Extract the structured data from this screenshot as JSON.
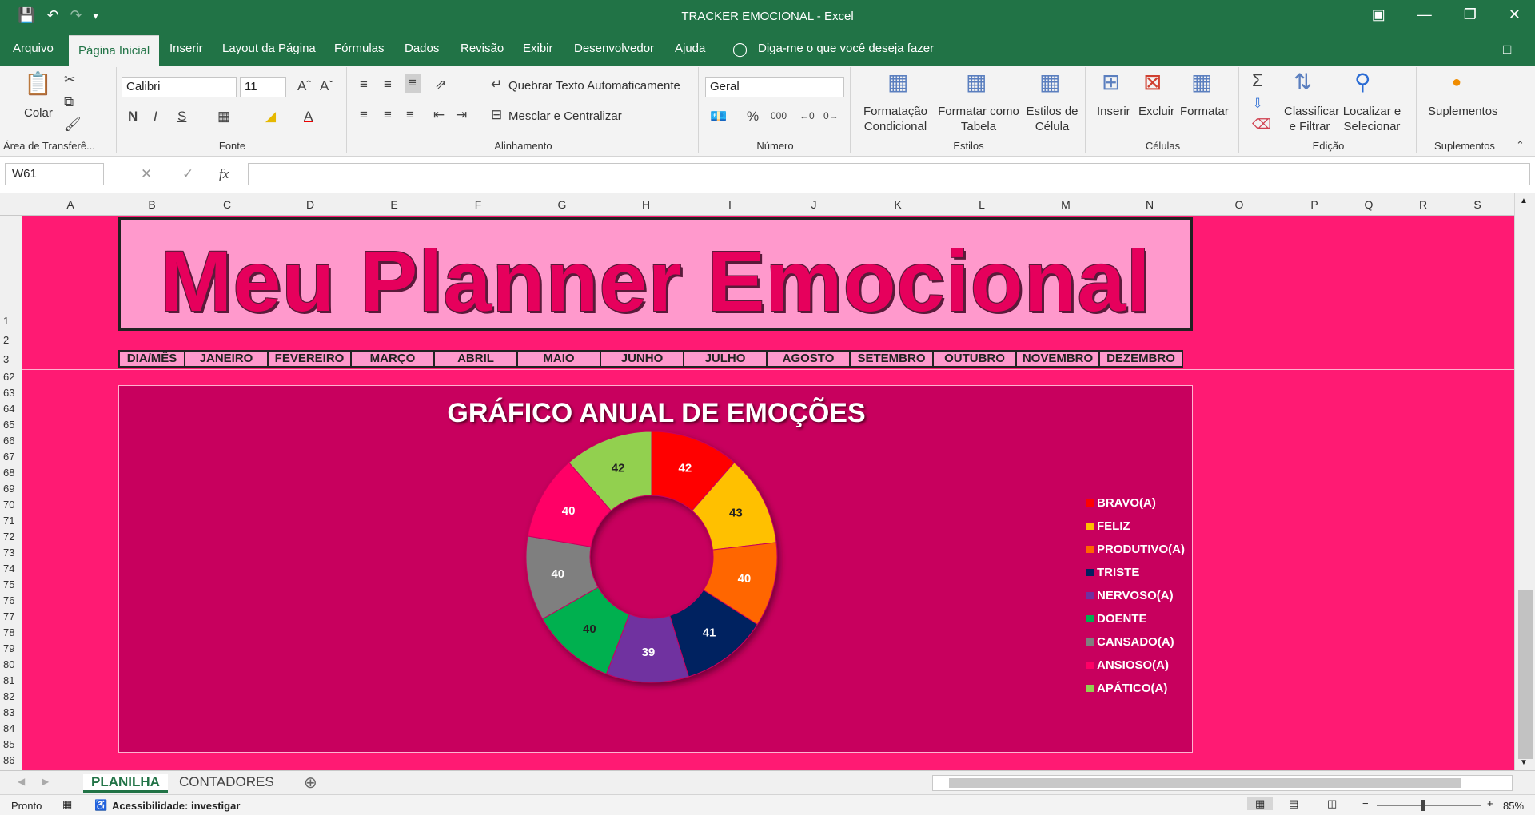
{
  "window": {
    "title": "TRACKER EMOCIONAL  -  Excel"
  },
  "menu": {
    "tabs": [
      "Arquivo",
      "Página Inicial",
      "Inserir",
      "Layout da Página",
      "Fórmulas",
      "Dados",
      "Revisão",
      "Exibir",
      "Desenvolvedor",
      "Ajuda"
    ],
    "tell_me": "Diga-me o que você deseja fazer"
  },
  "ribbon": {
    "clipboard": {
      "paste": "Colar",
      "label": "Área de Transferê..."
    },
    "font": {
      "name": "Calibri",
      "size": "11",
      "label": "Fonte"
    },
    "alignment": {
      "wrap": "Quebrar Texto Automaticamente",
      "merge": "Mesclar e Centralizar",
      "label": "Alinhamento"
    },
    "number": {
      "format": "Geral",
      "label": "Número"
    },
    "styles": {
      "conditional": "Formatação Condicional",
      "as_table": "Formatar como Tabela",
      "cell_styles": "Estilos de Célula",
      "label": "Estilos"
    },
    "cells": {
      "insert": "Inserir",
      "delete": "Excluir",
      "format": "Formatar",
      "label": "Células"
    },
    "editing": {
      "sort": "Classificar e Filtrar",
      "find": "Localizar e Selecionar",
      "label": "Edição"
    },
    "addins": {
      "button": "Suplementos",
      "label": "Suplementos"
    }
  },
  "formula_bar": {
    "name_box": "W61",
    "fx": "fx",
    "value": ""
  },
  "columns": [
    "A",
    "B",
    "C",
    "D",
    "E",
    "F",
    "G",
    "H",
    "I",
    "J",
    "K",
    "L",
    "M",
    "N",
    "O",
    "P",
    "Q",
    "R",
    "S"
  ],
  "rows": [
    "1",
    "2",
    "3",
    "62",
    "63",
    "64",
    "65",
    "66",
    "67",
    "68",
    "69",
    "70",
    "71",
    "72",
    "73",
    "74",
    "75",
    "76",
    "77",
    "78",
    "79",
    "80",
    "81",
    "82",
    "83",
    "84",
    "85",
    "86"
  ],
  "sheet": {
    "banner": "Meu Planner Emocional",
    "months": [
      "DIA/MÊS",
      "JANEIRO",
      "FEVEREIRO",
      "MARÇO",
      "ABRIL",
      "MAIO",
      "JUNHO",
      "JULHO",
      "AGOSTO",
      "SETEMBRO",
      "OUTUBRO",
      "NOVEMBRO",
      "DEZEMBRO"
    ]
  },
  "chart_data": {
    "type": "pie",
    "title": "GRÁFICO ANUAL DE EMOÇÕES",
    "categories": [
      "BRAVO(A)",
      "FELIZ",
      "PRODUTIVO(A)",
      "TRISTE",
      "NERVOSO(A)",
      "DOENTE",
      "CANSADO(A)",
      "ANSIOSO(A)",
      "APÁTICO(A)"
    ],
    "values": [
      42,
      43,
      40,
      41,
      39,
      40,
      40,
      40,
      42
    ],
    "colors": [
      "#ff0000",
      "#ffc000",
      "#ff6600",
      "#002060",
      "#7030a0",
      "#00b050",
      "#7f7f7f",
      "#ff0066",
      "#92d050"
    ],
    "label_colors": [
      "#ffffff",
      "#222222",
      "#ffffff",
      "#ffffff",
      "#ffffff",
      "#222222",
      "#ffffff",
      "#ffffff",
      "#222222"
    ],
    "donut": true,
    "legend": "right"
  },
  "sheet_tabs": [
    "PLANILHA",
    "CONTADORES"
  ],
  "status": {
    "ready": "Pronto",
    "accessibility": "Acessibilidade: investigar",
    "zoom": "85%"
  }
}
